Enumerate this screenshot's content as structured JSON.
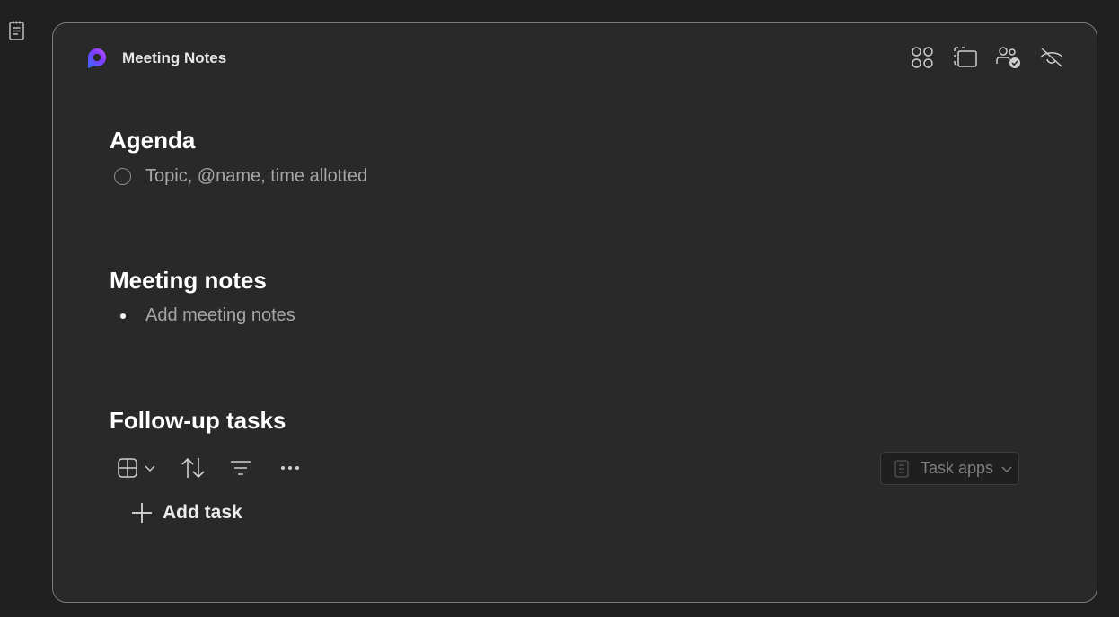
{
  "card": {
    "title": "Meeting Notes"
  },
  "header_actions": [
    {
      "icon": "apps-grid-icon"
    },
    {
      "icon": "select-region-icon"
    },
    {
      "icon": "people-check-icon"
    },
    {
      "icon": "eye-off-icon"
    }
  ],
  "sections": {
    "agenda": {
      "heading": "Agenda",
      "placeholder": "Topic, @name, time allotted"
    },
    "notes": {
      "heading": "Meeting notes",
      "placeholder": "Add meeting notes"
    },
    "tasks": {
      "heading": "Follow-up tasks",
      "add_task_label": "Add task",
      "task_apps_label": "Task apps"
    }
  },
  "colors": {
    "background": "#202020",
    "card": "#292929",
    "border": "#7a7a7a",
    "placeholder": "#a6a6a6",
    "logo_gradient_start": "#3b6cff",
    "logo_gradient_end": "#b44dff"
  }
}
